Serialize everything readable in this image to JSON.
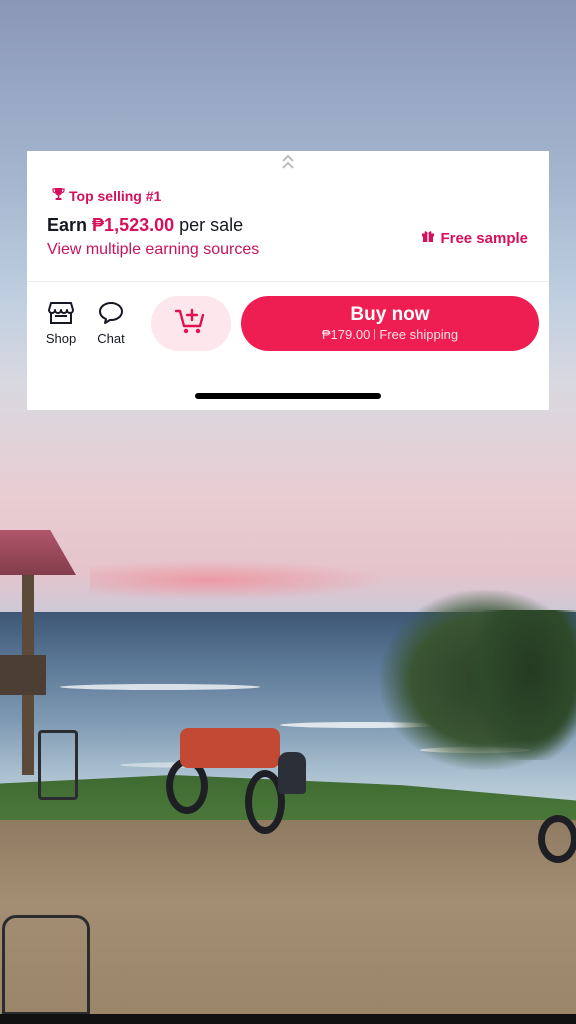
{
  "panel": {
    "badge": {
      "icon": "trophy-icon",
      "label": "Top selling #1"
    },
    "earn": {
      "lead": "Earn",
      "amount": "₱1,523.00",
      "tail": "per sale"
    },
    "earn_link": "View multiple earning sources",
    "free_sample": {
      "icon": "gift-icon",
      "label": "Free sample"
    },
    "collapse_icon": "chevron-up-double-icon"
  },
  "actions": {
    "shop": {
      "icon": "store-icon",
      "label": "Shop"
    },
    "chat": {
      "icon": "chat-bubble-icon",
      "label": "Chat"
    },
    "add_to_cart": {
      "icon": "cart-plus-icon"
    },
    "buy": {
      "title": "Buy now",
      "price": "₱179.00",
      "shipping": "Free shipping"
    }
  },
  "colors": {
    "accent": "#ee1d52",
    "accent_text": "#d6105c",
    "cart_bg": "#fde6ec"
  }
}
